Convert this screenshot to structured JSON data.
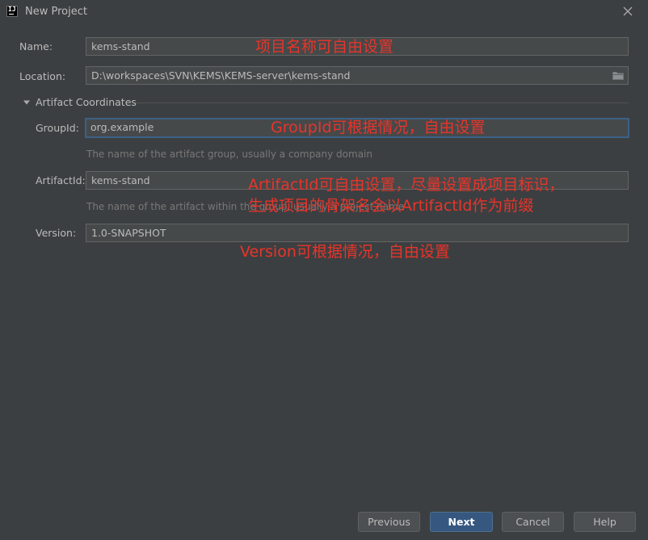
{
  "window": {
    "title": "New Project",
    "icon": "intellij-idea-icon",
    "close_icon": "close-icon"
  },
  "form": {
    "name_label": "Name:",
    "name_value": "kems-stand",
    "location_label": "Location:",
    "location_value": "D:\\workspaces\\SVN\\KEMS\\KEMS-server\\kems-stand",
    "section_title": "Artifact Coordinates",
    "groupid_label": "GroupId:",
    "groupid_value": "org.example",
    "groupid_hint": "The name of the artifact group, usually a company domain",
    "artifactid_label": "ArtifactId:",
    "artifactid_value": "kems-stand",
    "artifactid_hint": "The name of the artifact within the group, usually a project name",
    "version_label": "Version:",
    "version_value": "1.0-SNAPSHOT"
  },
  "annotations": {
    "name_note": "项目名称可自由设置",
    "groupid_note": "GroupId可根据情况，自由设置",
    "artifactid_note_1": "ArtifactId可自由设置，尽量设置成项目标识，",
    "artifactid_note_2": "生成项目的骨架名会以ArtifactId作为前缀",
    "version_note": "Version可根据情况，自由设置"
  },
  "buttons": {
    "previous": "Previous",
    "next": "Next",
    "cancel": "Cancel",
    "help": "Help"
  },
  "colors": {
    "background": "#3c3f41",
    "field_bg": "#45494a",
    "focus_border": "#3d6185",
    "primary_button": "#365880",
    "annotation_red": "#e8342a",
    "hint_text": "#787878"
  }
}
